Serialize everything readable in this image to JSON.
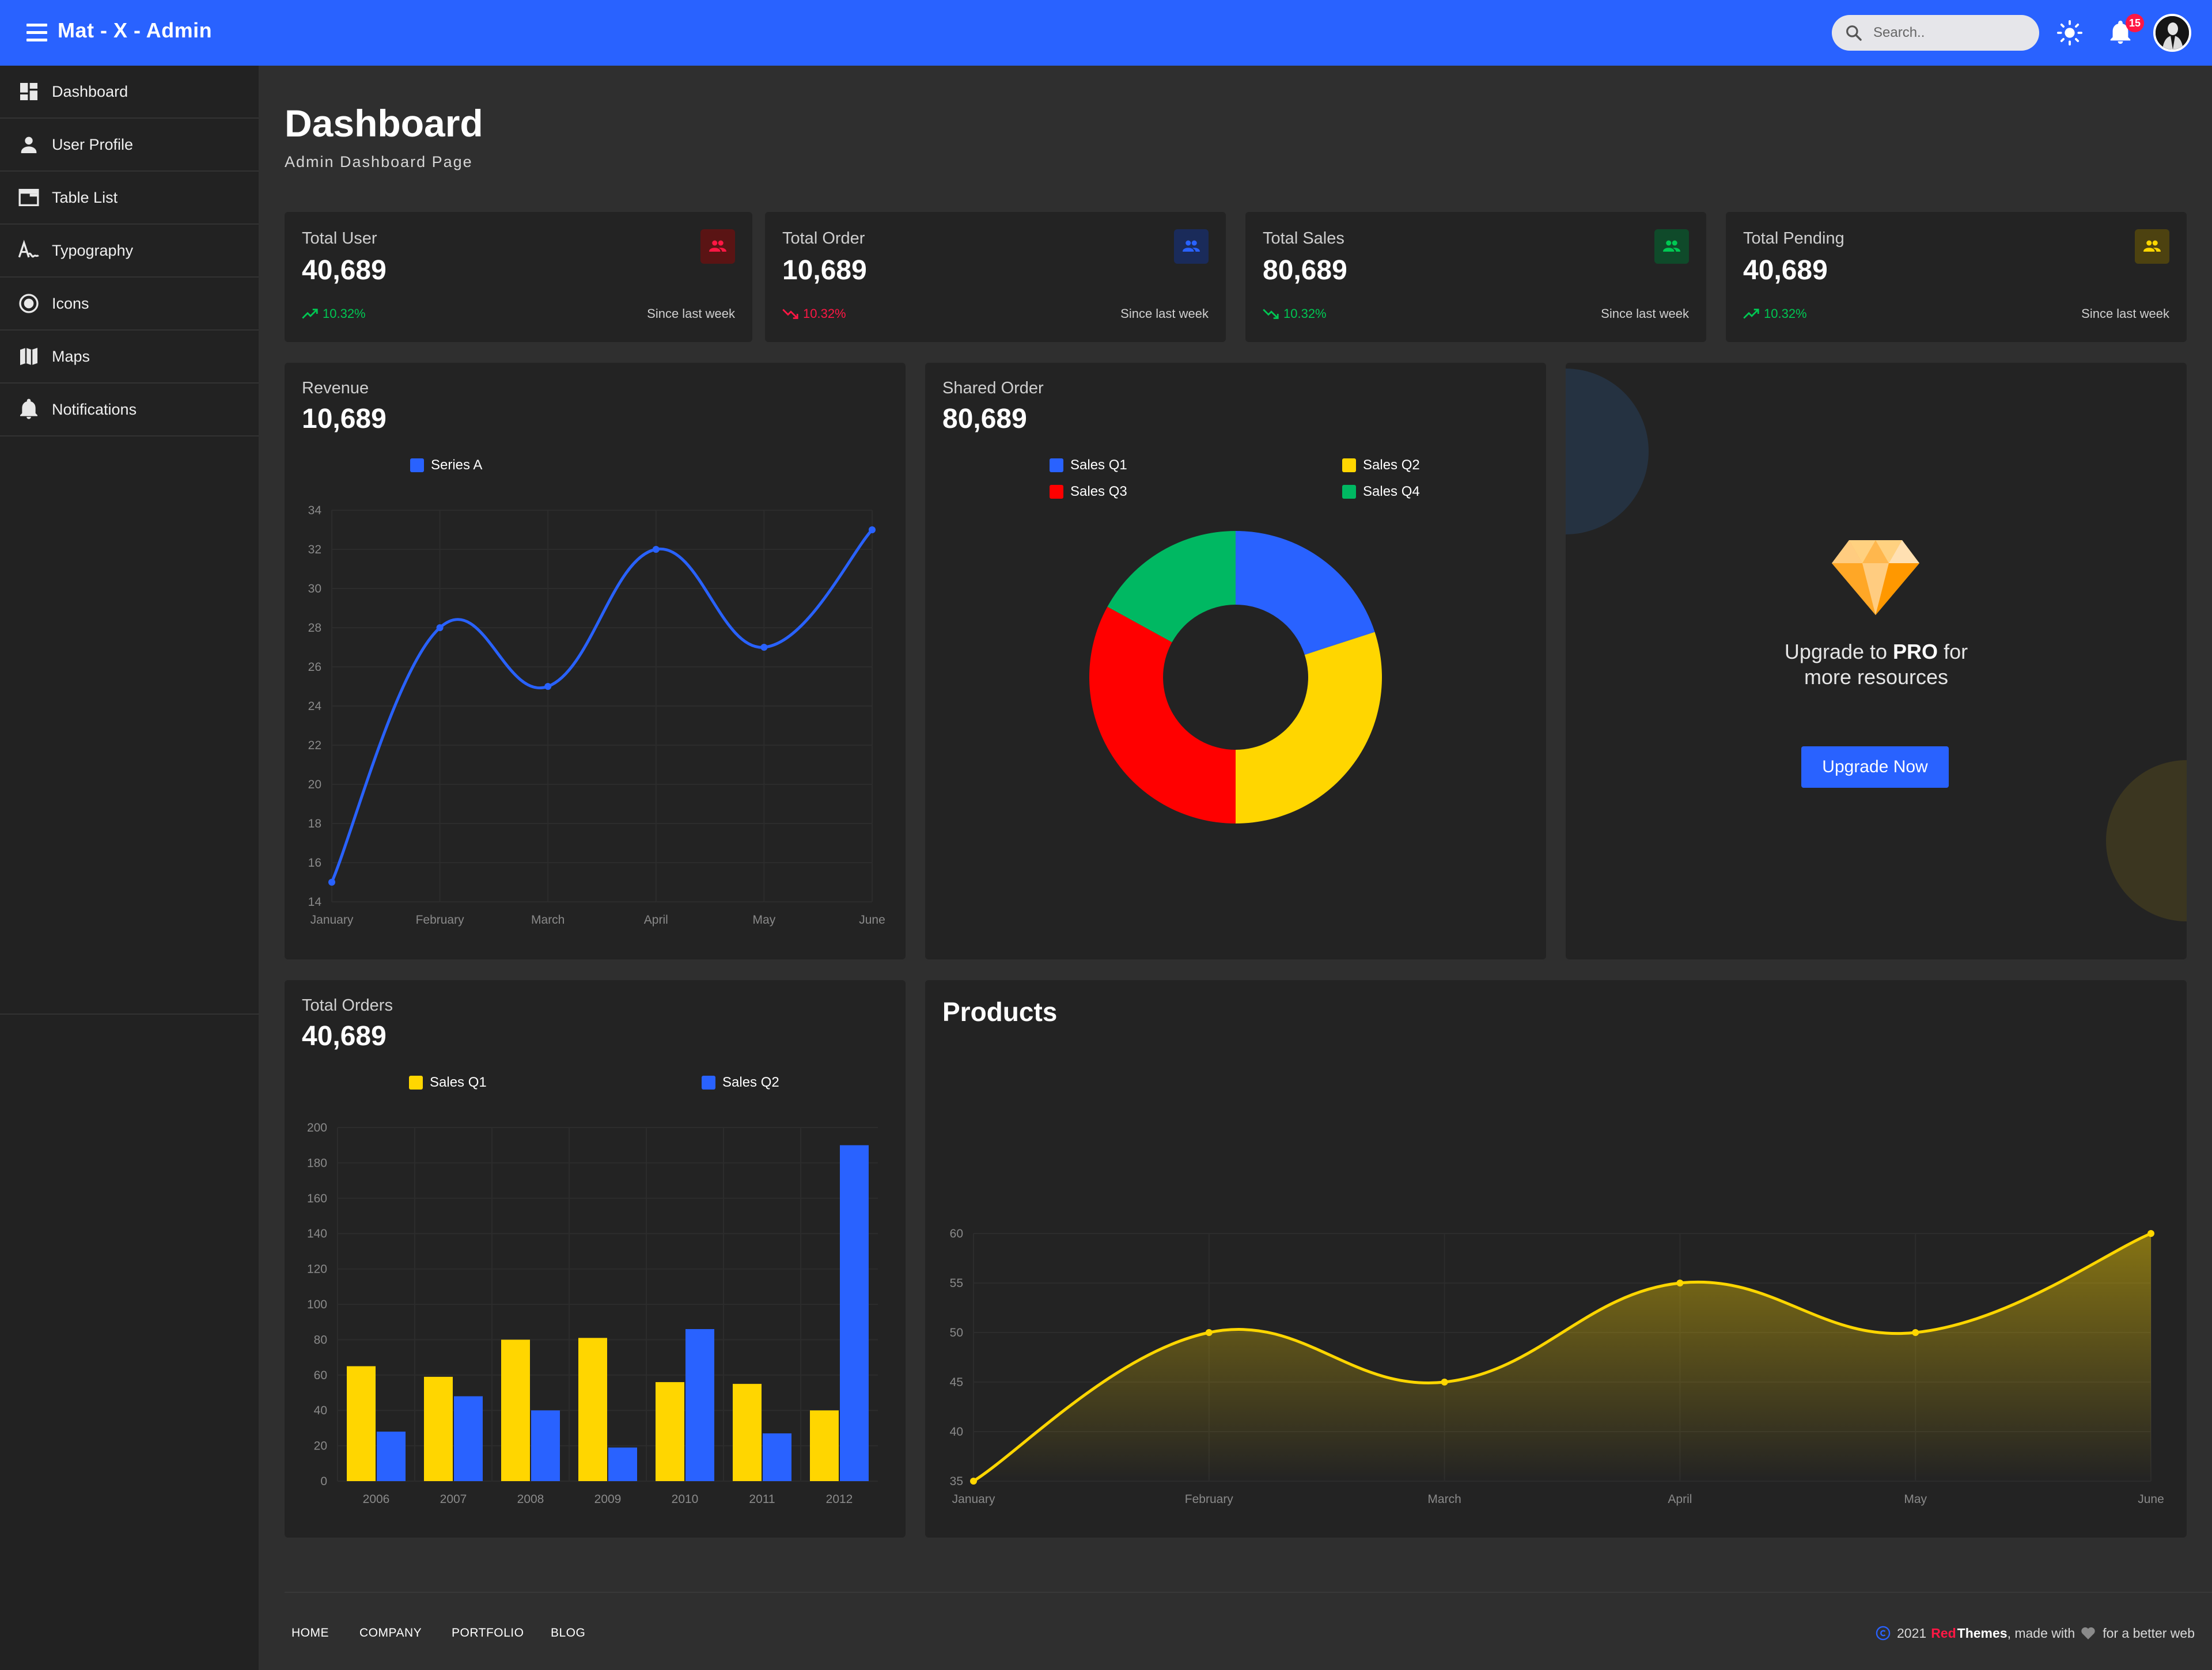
{
  "app": {
    "title": "Mat - X - Admin",
    "search_placeholder": "Search..",
    "notification_count": "15"
  },
  "colors": {
    "primary": "#2962ff",
    "yellow": "#ffd600",
    "red": "#ff0000",
    "green": "#00b862"
  },
  "sidebar": {
    "items": [
      {
        "label": "Dashboard",
        "icon": "dashboard-icon"
      },
      {
        "label": "User Profile",
        "icon": "person-icon"
      },
      {
        "label": "Table List",
        "icon": "table-icon"
      },
      {
        "label": "Typography",
        "icon": "typography-icon"
      },
      {
        "label": "Icons",
        "icon": "radio-icon"
      },
      {
        "label": "Maps",
        "icon": "map-icon"
      },
      {
        "label": "Notifications",
        "icon": "bell-icon"
      }
    ]
  },
  "page": {
    "title": "Dashboard",
    "subtitle": "Admin Dashboard Page"
  },
  "stats": [
    {
      "label": "Total User",
      "value": "40,689",
      "change": "10.32%",
      "trend": "up",
      "since": "Since last week",
      "icon": "group-icon",
      "color": "#ff1744"
    },
    {
      "label": "Total Order",
      "value": "10,689",
      "change": "10.32%",
      "trend": "down",
      "since": "Since last week",
      "icon": "group-icon",
      "color": "#2962ff"
    },
    {
      "label": "Total Sales",
      "value": "80,689",
      "change": "10.32%",
      "trend": "down",
      "since": "Since last week",
      "icon": "group-icon",
      "color": "#00c853"
    },
    {
      "label": "Total Pending",
      "value": "40,689",
      "change": "10.32%",
      "trend": "up",
      "since": "Since last week",
      "icon": "group-icon",
      "color": "#ffd600"
    }
  ],
  "revenue": {
    "label": "Revenue",
    "value": "10,689"
  },
  "shared": {
    "label": "Shared Order",
    "value": "80,689"
  },
  "orders": {
    "label": "Total Orders",
    "value": "40,689"
  },
  "products": {
    "heading": "Products"
  },
  "upgrade": {
    "line1_pre": "Upgrade to ",
    "line1_bold": "PRO",
    "line1_post": " for",
    "line2": "more resources",
    "button": "Upgrade Now"
  },
  "footer": {
    "links": [
      "HOME",
      "COMPANY",
      "PORTFOLIO",
      "BLOG"
    ],
    "year": "2021",
    "brand_red": "Red",
    "brand_bold": "Themes",
    "made_with": ", made with",
    "better_web": "for a better web"
  },
  "chart_data": [
    {
      "type": "line",
      "categories": [
        "January",
        "February",
        "March",
        "April",
        "May",
        "June"
      ],
      "series": [
        {
          "name": "Series A",
          "values": [
            15,
            28,
            25,
            32,
            27,
            33
          ],
          "color": "#2962ff"
        }
      ],
      "ylim": [
        14,
        34
      ],
      "yticks": [
        14,
        16,
        18,
        20,
        22,
        24,
        26,
        28,
        30,
        32,
        34
      ],
      "grid": true,
      "legend": "top"
    },
    {
      "type": "pie",
      "donut": true,
      "series": [
        {
          "name": "Sales Q1",
          "value": 20,
          "color": "#2962ff"
        },
        {
          "name": "Sales Q2",
          "value": 30,
          "color": "#ffd600"
        },
        {
          "name": "Sales Q3",
          "value": 33,
          "color": "#ff0000"
        },
        {
          "name": "Sales Q4",
          "value": 17,
          "color": "#00b862"
        }
      ],
      "legend": "top"
    },
    {
      "type": "bar",
      "categories": [
        "2006",
        "2007",
        "2008",
        "2009",
        "2010",
        "2011",
        "2012"
      ],
      "series": [
        {
          "name": "Sales Q1",
          "values": [
            65,
            59,
            80,
            81,
            56,
            55,
            40
          ],
          "color": "#ffd600"
        },
        {
          "name": "Sales Q2",
          "values": [
            28,
            48,
            40,
            19,
            86,
            27,
            190
          ],
          "color": "#2962ff"
        }
      ],
      "ylim": [
        0,
        200
      ],
      "yticks": [
        0,
        20,
        40,
        60,
        80,
        100,
        120,
        140,
        160,
        180,
        200
      ],
      "grid": true,
      "legend": "top"
    },
    {
      "type": "area",
      "categories": [
        "January",
        "February",
        "March",
        "April",
        "May",
        "June"
      ],
      "series": [
        {
          "name": "",
          "values": [
            35,
            50,
            45,
            55,
            50,
            60
          ],
          "color": "#ffd600"
        }
      ],
      "ylim": [
        35,
        60
      ],
      "yticks": [
        35,
        40,
        45,
        50,
        55,
        60
      ],
      "grid": true
    }
  ]
}
